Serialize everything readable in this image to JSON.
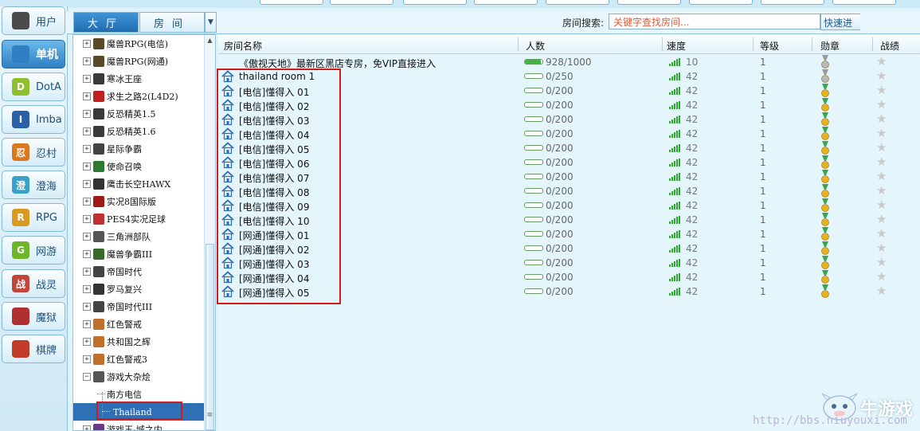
{
  "nav": {
    "items": [
      {
        "label": "用户",
        "icon": "user-icon",
        "badge": "",
        "active": false,
        "color": "#4a4a4a"
      },
      {
        "label": "单机",
        "icon": "single-player-icon",
        "badge": "",
        "active": true,
        "color": "#2f7fc2"
      },
      {
        "label": "DotA",
        "icon": "dota-icon",
        "badge": "D",
        "active": false,
        "color": "#8fbf2f"
      },
      {
        "label": "Imba",
        "icon": "imba-icon",
        "badge": "I",
        "active": false,
        "color": "#2b5fa8"
      },
      {
        "label": "忍村",
        "icon": "ninja-village-icon",
        "badge": "忍",
        "active": false,
        "color": "#d9781f"
      },
      {
        "label": "澄海",
        "icon": "chenghai-icon",
        "badge": "澄",
        "active": false,
        "color": "#3aa2c8"
      },
      {
        "label": "RPG",
        "icon": "rpg-icon",
        "badge": "R",
        "active": false,
        "color": "#d99a1f"
      },
      {
        "label": "网游",
        "icon": "online-game-icon",
        "badge": "G",
        "active": false,
        "color": "#6fb52c"
      },
      {
        "label": "战灵",
        "icon": "war-spirit-icon",
        "badge": "战",
        "active": false,
        "color": "#c2453a"
      },
      {
        "label": "魔狱",
        "icon": "demon-prison-icon",
        "badge": "",
        "active": false,
        "color": "#b03030"
      },
      {
        "label": "棋牌",
        "icon": "cards-icon",
        "badge": "",
        "active": false,
        "color": "#c23a2a"
      }
    ]
  },
  "tabs": {
    "hall": "大厅",
    "room": "房间",
    "dropdown": "▼"
  },
  "search": {
    "label": "房间搜索:",
    "placeholder": "关键字查找房间...",
    "quick_button": "快速进"
  },
  "tree": {
    "scroll_up": "▲",
    "scroll_grip": "≡",
    "nodes": [
      {
        "label": "魔兽RPG(电信)",
        "toggle": "+",
        "icon": "warcraft-rpg-icon",
        "color": "#5b4a2a"
      },
      {
        "label": "魔兽RPG(网通)",
        "toggle": "+",
        "icon": "warcraft-rpg-icon",
        "color": "#5b4a2a"
      },
      {
        "label": "寒冰王座",
        "toggle": "+",
        "icon": "frozen-throne-icon",
        "color": "#3a3a3a"
      },
      {
        "label": "求生之路2(L4D2)",
        "toggle": "+",
        "icon": "left4dead-icon",
        "color": "#c02020"
      },
      {
        "label": "反恐精英1.5",
        "toggle": "+",
        "icon": "counter-strike-icon",
        "color": "#3a3a3a"
      },
      {
        "label": "反恐精英1.6",
        "toggle": "+",
        "icon": "counter-strike-icon",
        "color": "#3a3a3a"
      },
      {
        "label": "星际争霸",
        "toggle": "+",
        "icon": "starcraft-icon",
        "color": "#444444"
      },
      {
        "label": "使命召唤",
        "toggle": "+",
        "icon": "call-of-duty-icon",
        "color": "#2f7a2f"
      },
      {
        "label": "鹰击长空HAWX",
        "toggle": "+",
        "icon": "hawx-icon",
        "color": "#333333"
      },
      {
        "label": "实况8国际版",
        "toggle": "+",
        "icon": "pes8-icon",
        "color": "#a01818"
      },
      {
        "label": "PES4实况足球",
        "toggle": "+",
        "icon": "pes4-icon",
        "color": "#c03030"
      },
      {
        "label": "三角洲部队",
        "toggle": "+",
        "icon": "delta-force-icon",
        "color": "#555555"
      },
      {
        "label": "魔兽争霸III",
        "toggle": "+",
        "icon": "warcraft3-icon",
        "color": "#3a6a2a"
      },
      {
        "label": "帝国时代",
        "toggle": "+",
        "icon": "age-of-empires-icon",
        "color": "#444444"
      },
      {
        "label": "罗马复兴",
        "toggle": "+",
        "icon": "rome-icon",
        "color": "#333333"
      },
      {
        "label": "帝国时代III",
        "toggle": "+",
        "icon": "age-of-empires3-icon",
        "color": "#444444"
      },
      {
        "label": "红色警戒",
        "toggle": "+",
        "icon": "red-alert-icon",
        "color": "#c0702a"
      },
      {
        "label": "共和国之辉",
        "toggle": "+",
        "icon": "red-alert-republic-icon",
        "color": "#c0702a"
      },
      {
        "label": "红色警戒3",
        "toggle": "+",
        "icon": "red-alert3-icon",
        "color": "#c0702a"
      },
      {
        "label": "游戏大杂烩",
        "toggle": "−",
        "icon": "game-medley-icon",
        "color": "#555555"
      },
      {
        "label": "游戏王-城之内",
        "toggle": "+",
        "icon": "yugioh-icon",
        "color": "#6a3a8a"
      }
    ],
    "children": [
      {
        "label": "南方电信",
        "selected": false
      },
      {
        "label": "Thailand",
        "selected": true
      }
    ]
  },
  "rooms": {
    "headers": {
      "name": "房间名称",
      "players": "人数",
      "speed": "速度",
      "level": "等级",
      "medal": "勋章",
      "record": "战绩"
    },
    "rows": [
      {
        "name": "《傲视天地》最新区黑店专房，免VIP直接进入",
        "count": "928/1000",
        "fill": 0.928,
        "speed": "10",
        "level": "1",
        "medal": "silver",
        "star": "★",
        "house": false
      },
      {
        "name": "thailand room 1",
        "count": "0/250",
        "fill": 0,
        "speed": "42",
        "level": "1",
        "medal": "silver",
        "star": "★",
        "house": true
      },
      {
        "name": "[电信]懂得入 01",
        "count": "0/200",
        "fill": 0,
        "speed": "42",
        "level": "1",
        "medal": "gold",
        "star": "★",
        "house": true
      },
      {
        "name": "[电信]懂得入 02",
        "count": "0/200",
        "fill": 0,
        "speed": "42",
        "level": "1",
        "medal": "gold",
        "star": "★",
        "house": true
      },
      {
        "name": "[电信]懂得入 03",
        "count": "0/200",
        "fill": 0,
        "speed": "42",
        "level": "1",
        "medal": "gold",
        "star": "★",
        "house": true
      },
      {
        "name": "[电信]懂得入 04",
        "count": "0/200",
        "fill": 0,
        "speed": "42",
        "level": "1",
        "medal": "gold",
        "star": "★",
        "house": true
      },
      {
        "name": "[电信]懂得入 05",
        "count": "0/200",
        "fill": 0,
        "speed": "42",
        "level": "1",
        "medal": "gold",
        "star": "★",
        "house": true
      },
      {
        "name": "[电信]懂得入 06",
        "count": "0/200",
        "fill": 0,
        "speed": "42",
        "level": "1",
        "medal": "gold",
        "star": "★",
        "house": true
      },
      {
        "name": "[电信]懂得入 07",
        "count": "0/200",
        "fill": 0,
        "speed": "42",
        "level": "1",
        "medal": "gold",
        "star": "★",
        "house": true
      },
      {
        "name": "[电信]懂得入 08",
        "count": "0/200",
        "fill": 0,
        "speed": "42",
        "level": "1",
        "medal": "gold",
        "star": "★",
        "house": true
      },
      {
        "name": "[电信]懂得入 09",
        "count": "0/200",
        "fill": 0,
        "speed": "42",
        "level": "1",
        "medal": "gold",
        "star": "★",
        "house": true
      },
      {
        "name": "[电信]懂得入 10",
        "count": "0/200",
        "fill": 0,
        "speed": "42",
        "level": "1",
        "medal": "gold",
        "star": "★",
        "house": true
      },
      {
        "name": "[网通]懂得入 01",
        "count": "0/200",
        "fill": 0,
        "speed": "42",
        "level": "1",
        "medal": "gold",
        "star": "★",
        "house": true
      },
      {
        "name": "[网通]懂得入 02",
        "count": "0/200",
        "fill": 0,
        "speed": "42",
        "level": "1",
        "medal": "gold",
        "star": "★",
        "house": true
      },
      {
        "name": "[网通]懂得入 03",
        "count": "0/200",
        "fill": 0,
        "speed": "42",
        "level": "1",
        "medal": "gold",
        "star": "★",
        "house": true
      },
      {
        "name": "[网通]懂得入 04",
        "count": "0/200",
        "fill": 0,
        "speed": "42",
        "level": "1",
        "medal": "gold",
        "star": "★",
        "house": true
      },
      {
        "name": "[网通]懂得入 05",
        "count": "0/200",
        "fill": 0,
        "speed": "42",
        "level": "1",
        "medal": "gold",
        "star": "★",
        "house": true
      }
    ]
  },
  "colors": {
    "highlight_box": "#d11a1a",
    "selected_row": "#2f6fb5",
    "bar_fill": "#3fb63f",
    "accent": "#2f80c4"
  },
  "watermark": {
    "brand": "牛游戏",
    "url": "http://bbs.niuyouxi.com"
  }
}
